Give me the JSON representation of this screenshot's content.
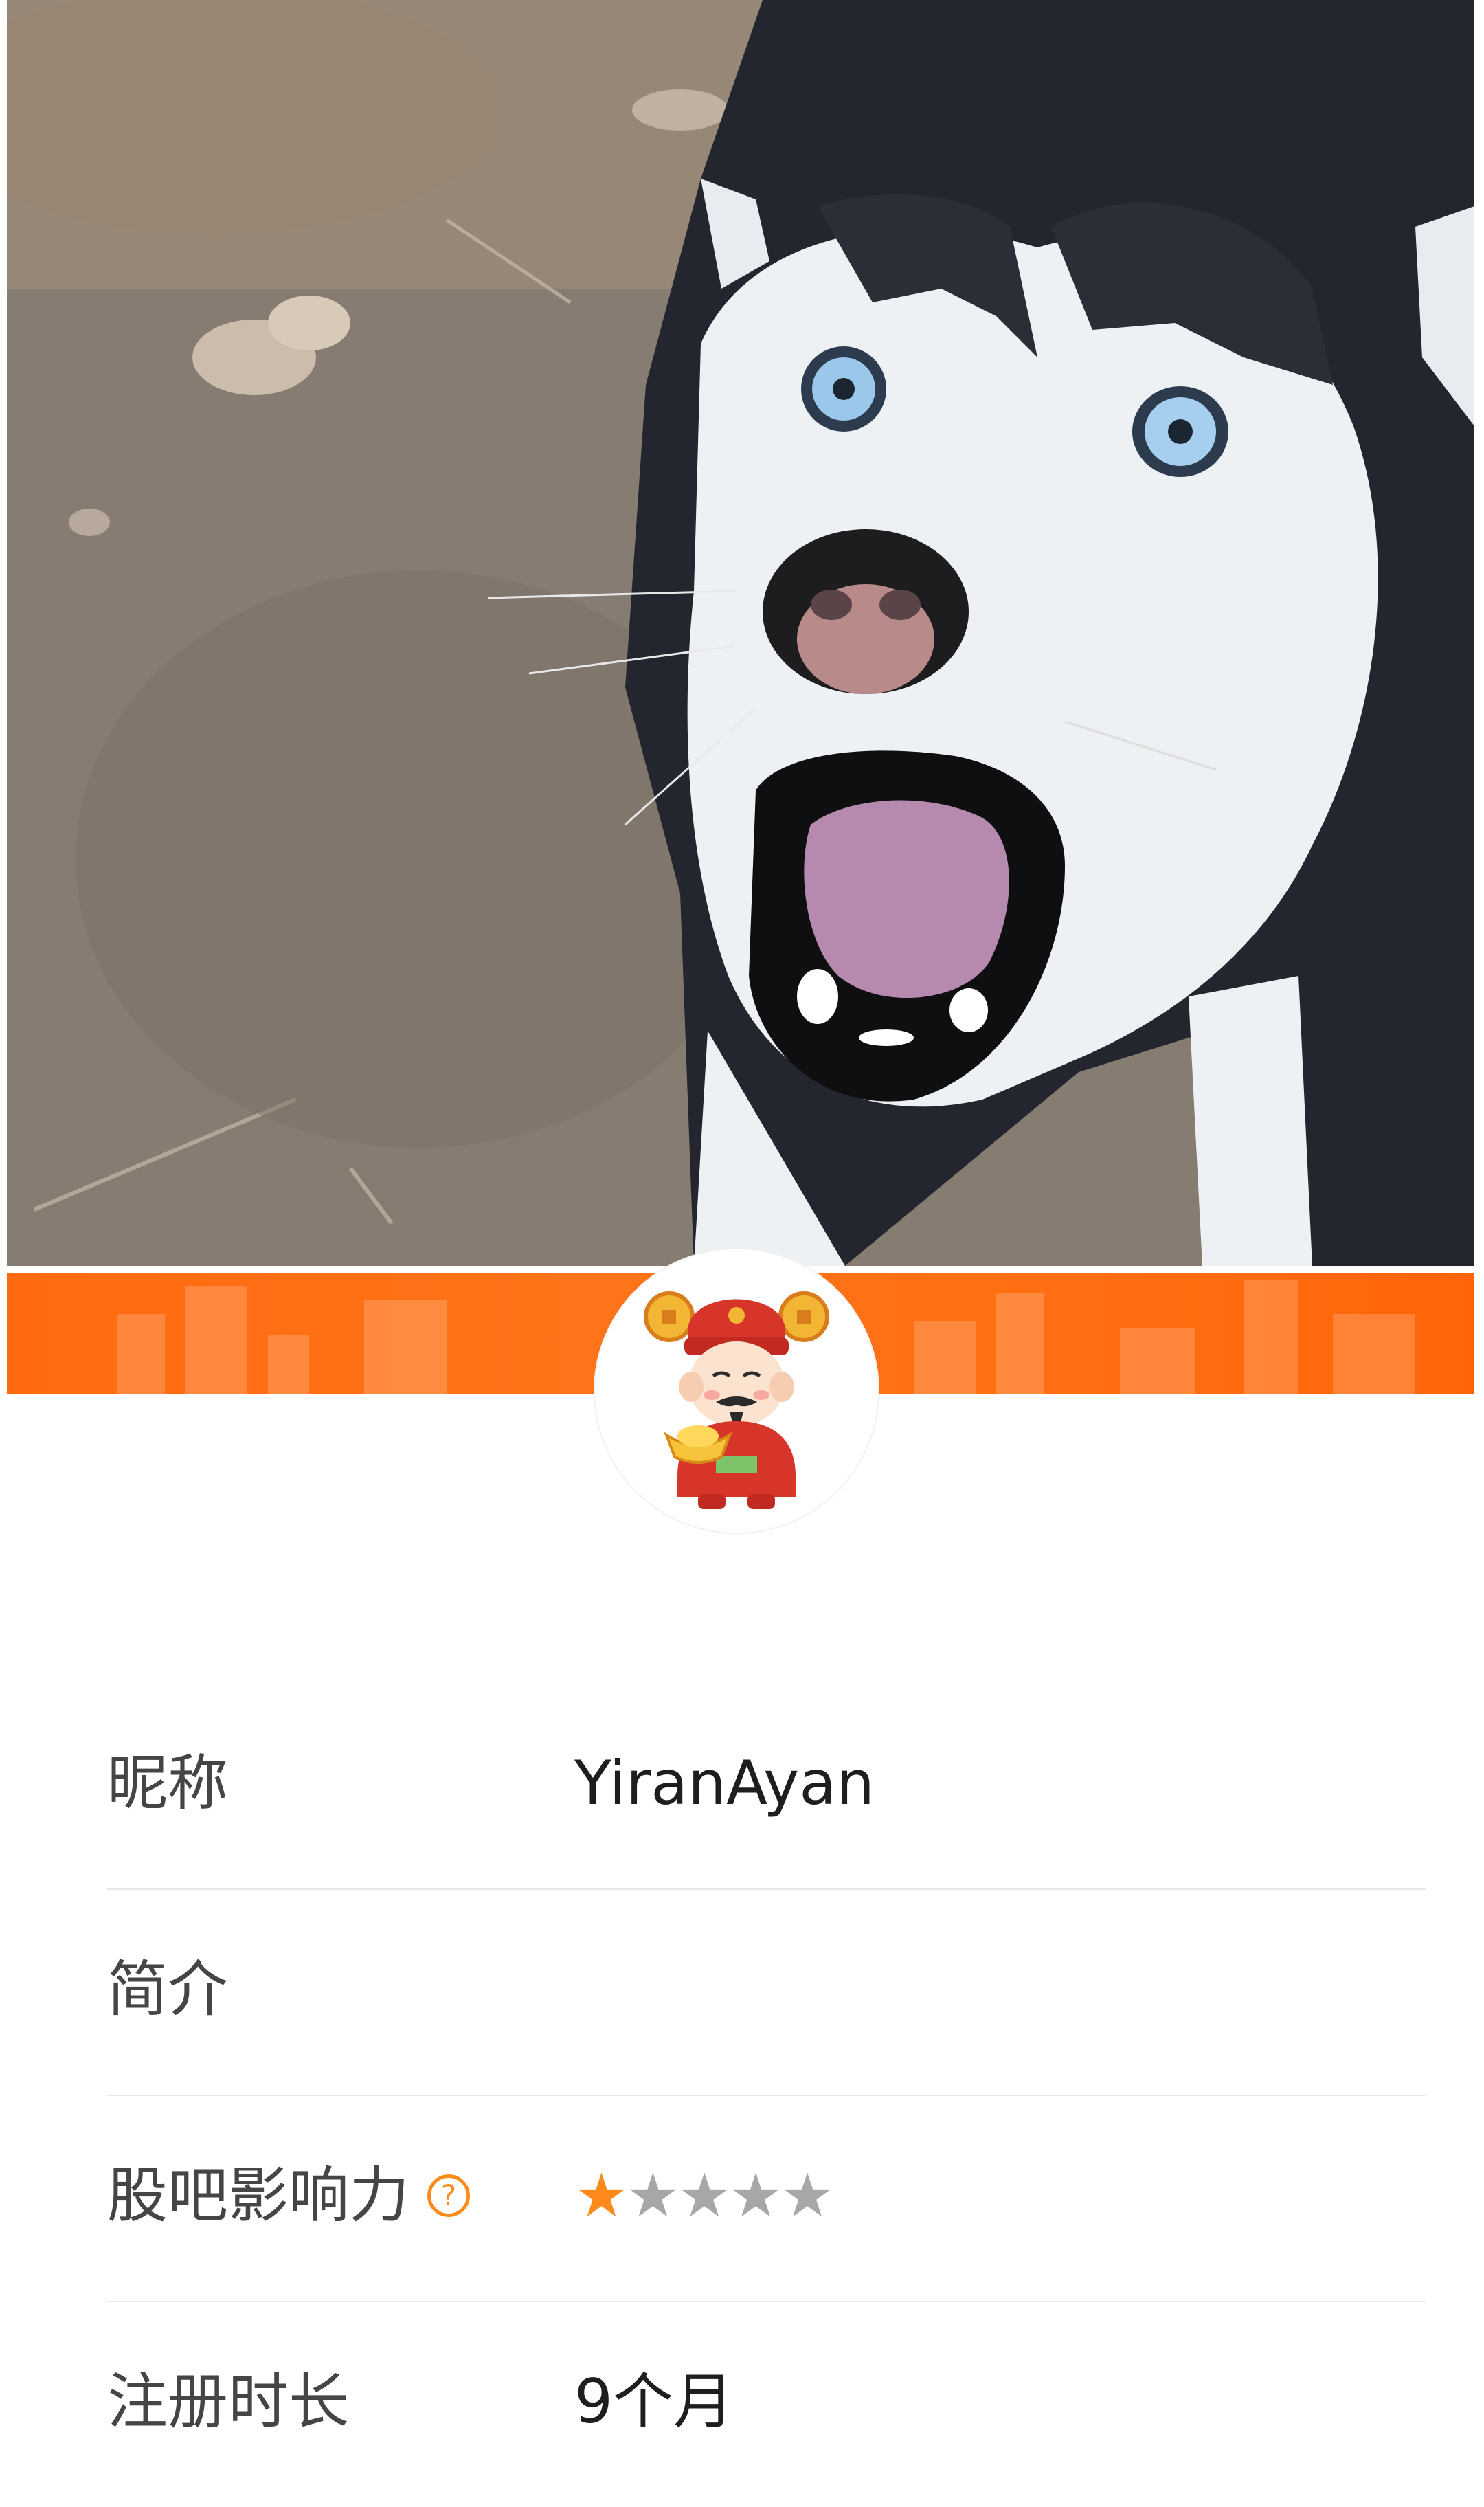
{
  "cover": {
    "image": "husky-dog-photo"
  },
  "avatar": {
    "image": "god-of-wealth-cartoon-avatar"
  },
  "profile": {
    "nickname_label": "昵称",
    "nickname_value": "YiranAyan",
    "bio_label": "简介",
    "bio_value": "",
    "influence_label": "股吧影响力",
    "influence_help_icon": "question-circle-icon",
    "influence_rating": 1,
    "influence_rating_max": 5,
    "influence_stars_on": "★",
    "influence_stars_off": "★★★★",
    "registration_label": "注册时长",
    "registration_value": "9个月"
  },
  "colors": {
    "banner": "#ff6f12",
    "star_active": "#ff8a1c",
    "star_inactive": "#a7a7a7",
    "help_icon": "#ff8c1a"
  }
}
